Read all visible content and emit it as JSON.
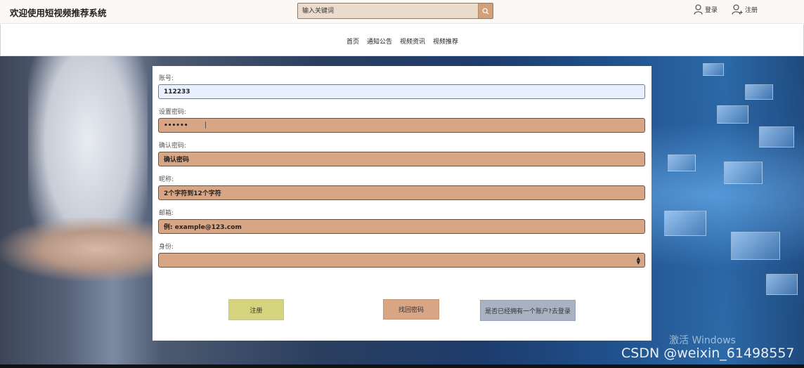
{
  "header": {
    "title": "欢迎使用短视频推荐系统",
    "search_placeholder": "输入关键词",
    "login_label": "登录",
    "register_label": "注册"
  },
  "nav": {
    "items": [
      "首页",
      "通知公告",
      "视频资讯",
      "视频推荐"
    ]
  },
  "form": {
    "account_label": "账号:",
    "account_value": "112233",
    "password_label": "设置密码:",
    "password_value": "••••••",
    "confirm_label": "确认密码:",
    "confirm_placeholder": "确认密码",
    "nickname_label": "昵称:",
    "nickname_placeholder": "2个字符到12个字符",
    "email_label": "邮箱:",
    "email_placeholder": "例: example@123.com",
    "identity_label": "身份:",
    "identity_value": ""
  },
  "buttons": {
    "register": "注册",
    "recover": "找回密码",
    "goto_login": "是否已经拥有一个账户?去登录"
  },
  "overlay": {
    "windows_watermark": "激活 Windows",
    "csdn": "CSDN @weixin_61498557"
  },
  "colors": {
    "input_bg": "#d9a685",
    "register_btn": "#d5d47e",
    "login_btn": "#a9b2c3"
  }
}
